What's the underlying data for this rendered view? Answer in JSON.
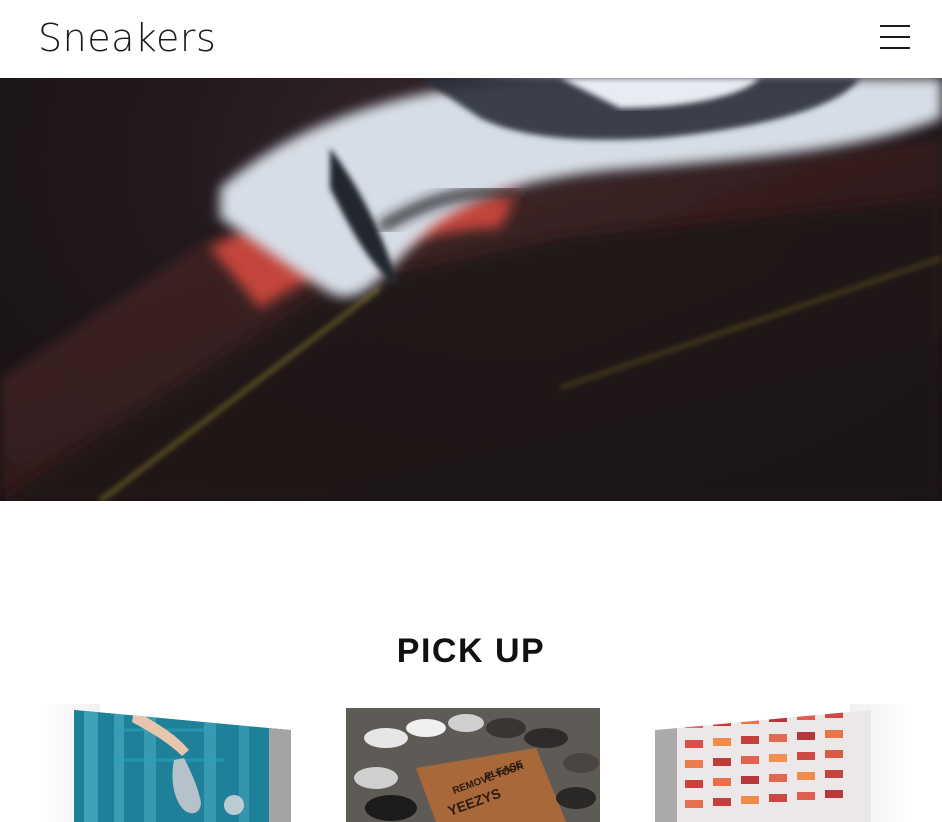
{
  "header": {
    "logo_text": "Sneakers",
    "menu_icon": "hamburger-menu-icon"
  },
  "hero": {
    "image": "blurred-sneaker-photo",
    "colors": {
      "shoe": "#d8dde6",
      "accent": "#d04a38",
      "background": "#1e1519"
    }
  },
  "pickup": {
    "title": "PICK UP",
    "cards": [
      {
        "image": "hand-holding-sneakers-teal-bridge-photo"
      },
      {
        "image": "sneakers-circle-doormat-photo",
        "doormat_text": "PLEASE REMOVE YOUR YEEZYS"
      },
      {
        "image": "sneaker-wall-display-photo"
      }
    ]
  }
}
